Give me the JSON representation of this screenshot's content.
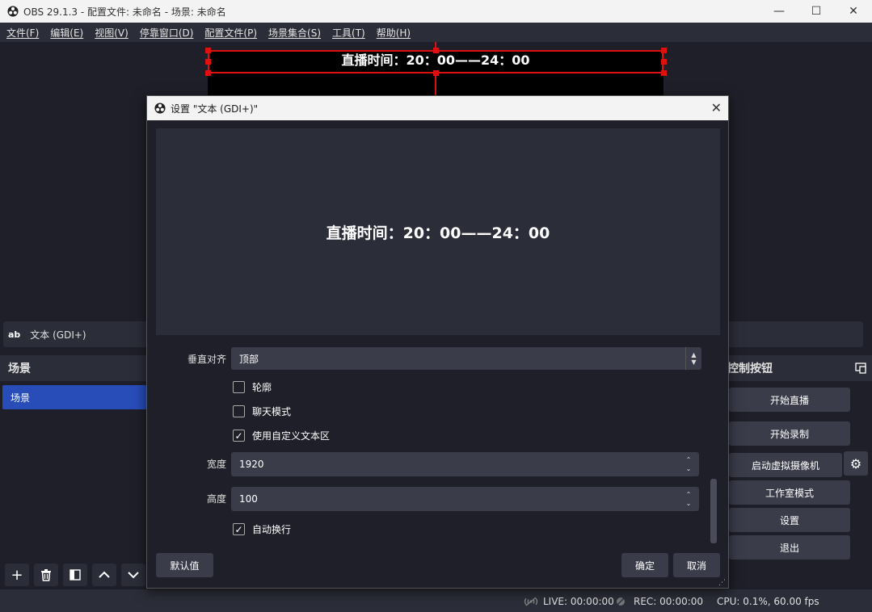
{
  "window": {
    "title": "OBS 29.1.3 - 配置文件: 未命名 - 场景: 未命名"
  },
  "menu": [
    "文件(F)",
    "编辑(E)",
    "视图(V)",
    "停靠窗口(D)",
    "配置文件(P)",
    "场景集合(S)",
    "工具(T)",
    "帮助(H)"
  ],
  "preview": {
    "text": "直播时间：20：00——24：00"
  },
  "source_bar": {
    "icon_text": "ab",
    "label": "文本 (GDI+)"
  },
  "scenes": {
    "header": "场景",
    "items": [
      "场景"
    ]
  },
  "controls": {
    "header": "控制按钮",
    "buttons": [
      "开始直播",
      "开始录制",
      "启动虚拟摄像机",
      "工作室模式",
      "设置",
      "退出"
    ]
  },
  "status": {
    "live": "LIVE: 00:00:00",
    "rec": "REC: 00:00:00",
    "cpu": "CPU: 0.1%, 60.00 fps"
  },
  "dialog": {
    "title": "设置 \"文本 (GDI+)\"",
    "preview_text": "直播时间：20：00——24：00",
    "valign_label": "垂直对齐",
    "valign_value": "顶部",
    "outline_label": "轮廓",
    "chat_mode_label": "聊天模式",
    "custom_area_label": "使用自定义文本区",
    "width_label": "宽度",
    "width_value": "1920",
    "height_label": "高度",
    "height_value": "100",
    "wrap_label": "自动换行",
    "defaults_button": "默认值",
    "ok_button": "确定",
    "cancel_button": "取消"
  }
}
